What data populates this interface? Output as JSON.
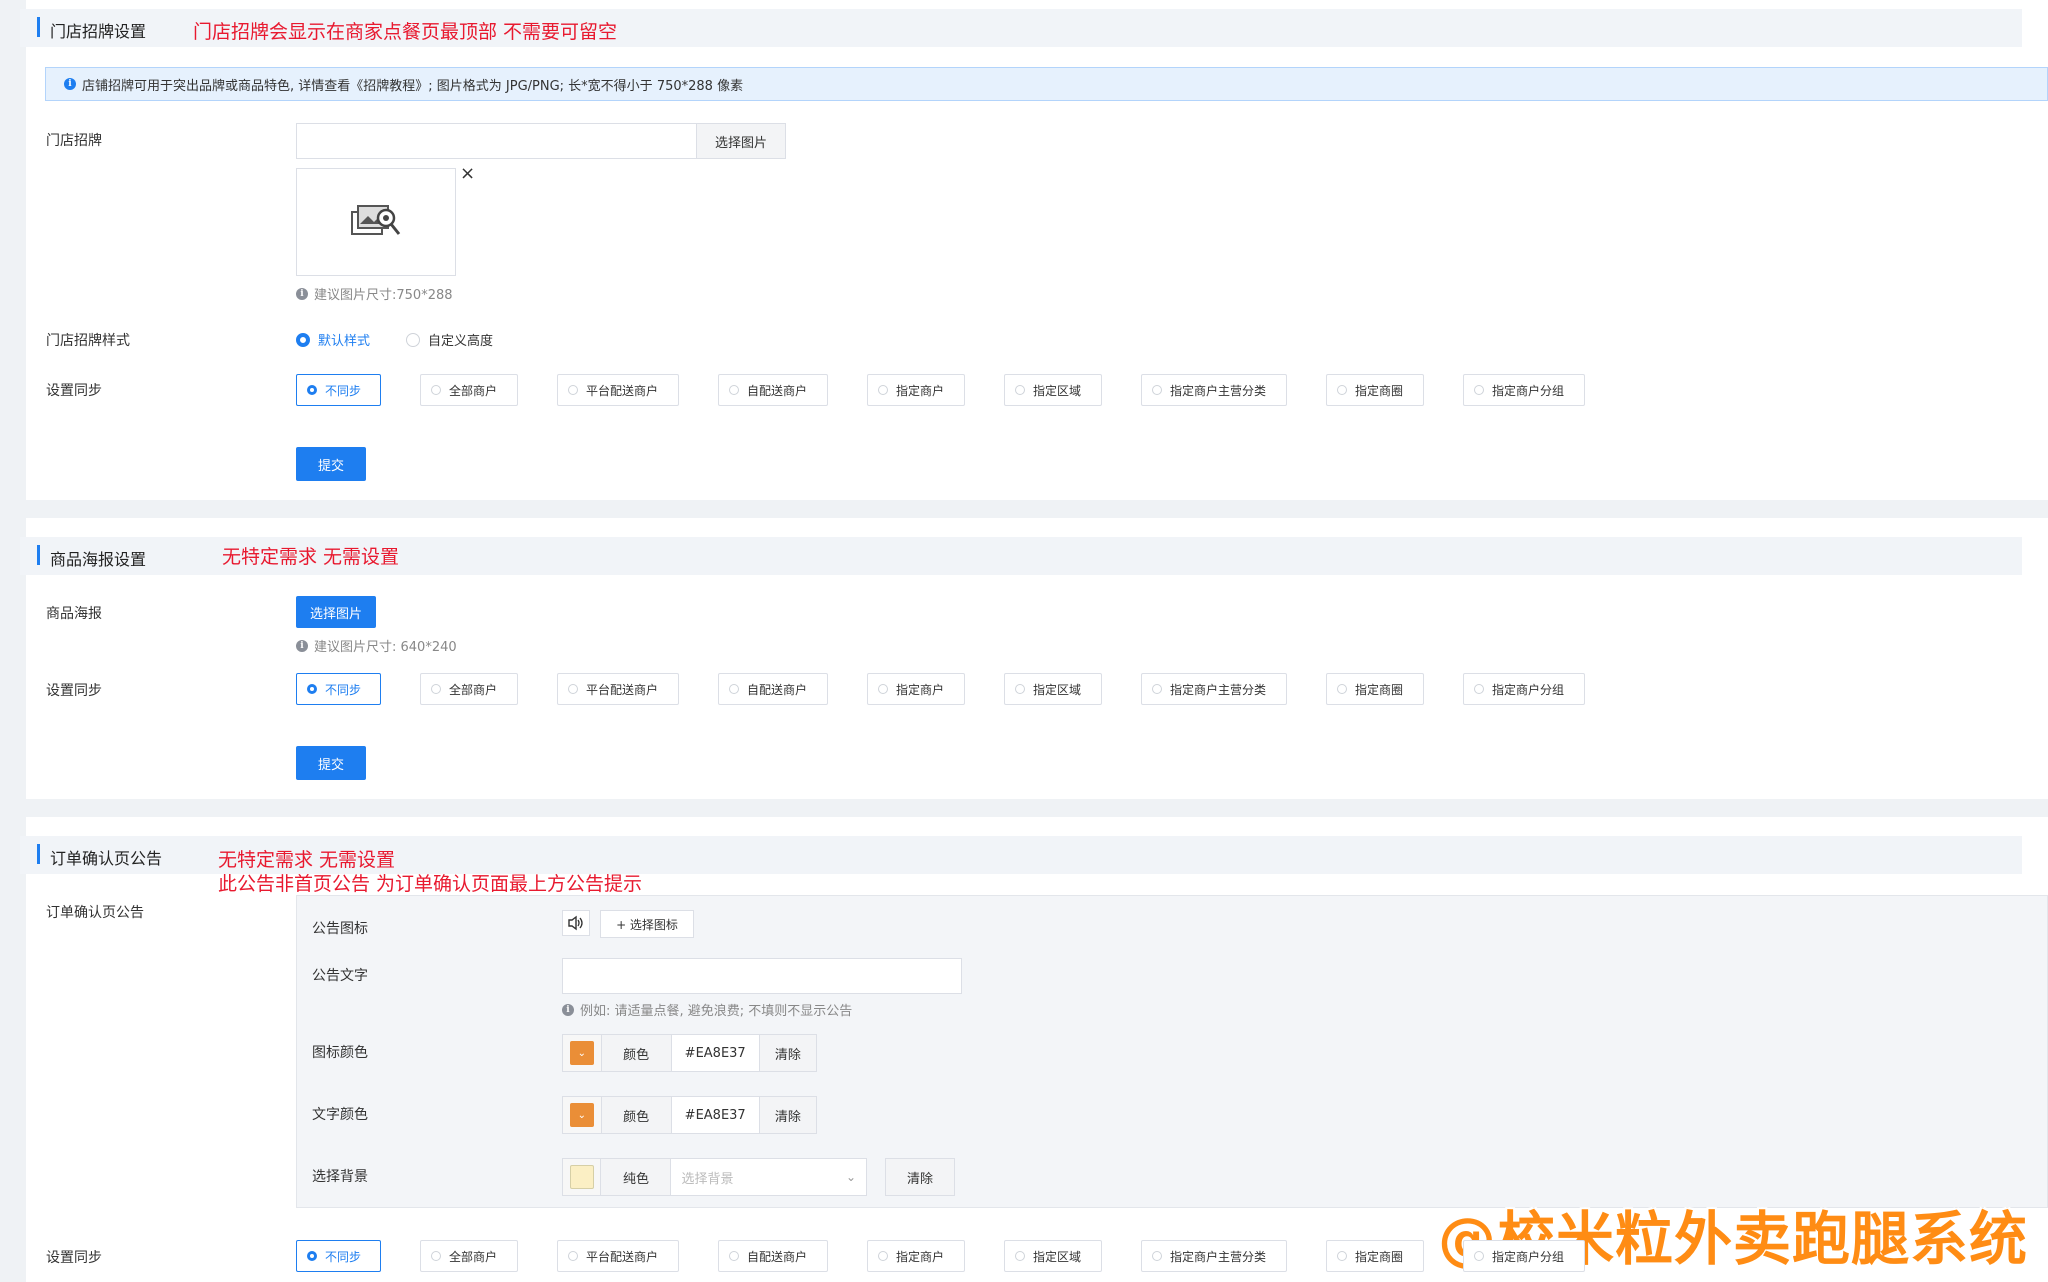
{
  "colors": {
    "primary": "#1e7ef0",
    "note_red": "#e8192f",
    "swatch_orange": "#EA8E37",
    "swatch_bg": "#fbefc4",
    "watermark": "#ff8c14"
  },
  "sync_options": [
    "不同步",
    "全部商户",
    "平台配送商户",
    "自配送商户",
    "指定商户",
    "指定区域",
    "指定商户主营分类",
    "指定商圈",
    "指定商户分组"
  ],
  "section1": {
    "title": "门店招牌设置",
    "note": "门店招牌会显示在商家点餐页最顶部 不需要可留空",
    "alert": "店铺招牌可用于突出品牌或商品特色, 详情查看《招牌教程》; 图片格式为 JPG/PNG; 长*宽不得小于 750*288 像素",
    "signboard_label": "门店招牌",
    "select_image_btn": "选择图片",
    "remove_icon": "×",
    "size_hint": "建议图片尺寸:750*288",
    "style_label": "门店招牌样式",
    "style_options": [
      "默认样式",
      "自定义高度"
    ],
    "sync_label": "设置同步",
    "submit": "提交"
  },
  "section2": {
    "title": "商品海报设置",
    "note": "无特定需求 无需设置",
    "poster_label": "商品海报",
    "select_image_btn": "选择图片",
    "size_hint": "建议图片尺寸: 640*240",
    "sync_label": "设置同步",
    "submit": "提交"
  },
  "section3": {
    "title": "订单确认页公告",
    "note_line1": "无特定需求 无需设置",
    "note_line2": "此公告非首页公告 为订单确认页面最上方公告提示",
    "field_label": "订单确认页公告",
    "icon_label": "公告图标",
    "select_icon_btn": "+ 选择图标",
    "text_label": "公告文字",
    "text_hint": "例如: 请适量点餐, 避免浪费; 不填则不显示公告",
    "icon_color_label": "图标颜色",
    "text_color_label": "文字颜色",
    "color_addon": "颜色",
    "color_value": "#EA8E37",
    "clear": "清除",
    "bg_label": "选择背景",
    "bg_addon": "纯色",
    "bg_placeholder": "选择背景",
    "bg_clear": "清除",
    "sync_label": "设置同步"
  },
  "watermark": "@校米粒外卖跑腿系统"
}
